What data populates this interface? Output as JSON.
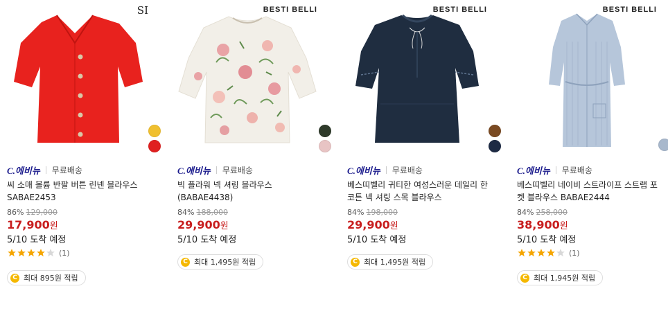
{
  "products": [
    {
      "brand_mark": "SI",
      "seller": "C.에비뉴",
      "shipping": "무료배송",
      "title": "씨 소매 볼륨 반팔 버튼 린넨 블라우스 SABAE2453",
      "discount": "86%",
      "original_price": "129,000",
      "price": "17,900",
      "currency": "원",
      "delivery": "5/10 도착 예정",
      "rating": 4,
      "rating_max": 5,
      "review_count": "(1)",
      "points": "최대 895원 적립",
      "swatch_colors": [
        "#f0c030",
        "#e02020"
      ],
      "garment_color": "#e8221e"
    },
    {
      "brand_mark": "BESTI BELLI",
      "seller": "C.에비뉴",
      "shipping": "무료배송",
      "title": "빅 플라워 넥 셔링 블라우스 (BABAE4438)",
      "discount": "84%",
      "original_price": "188,000",
      "price": "29,900",
      "currency": "원",
      "delivery": "5/10 도착 예정",
      "points": "최대 1,495원 적립",
      "swatch_colors": [
        "#2e3a2a",
        "#e8c4c4"
      ],
      "garment_color": "#f2efe8"
    },
    {
      "brand_mark": "BESTI BELLI",
      "seller": "C.에비뉴",
      "shipping": "무료배송",
      "title": "베스띠벨리 귀티한 여성스러운 데일리 한 코튼 넥 셔링 스목 블라우스",
      "discount": "84%",
      "original_price": "198,000",
      "price": "29,900",
      "currency": "원",
      "delivery": "5/10 도착 예정",
      "points": "최대 1,495원 적립",
      "swatch_colors": [
        "#7a4a22",
        "#1d2a44"
      ],
      "garment_color": "#1f2d40"
    },
    {
      "brand_mark": "BESTI BELLI",
      "seller": "C.에비뉴",
      "shipping": "무료배송",
      "title": "베스띠벨리 네이비 스트라이프 스트랩 포켓 블라우스 BABAE2444",
      "discount": "84%",
      "original_price": "258,000",
      "price": "38,900",
      "currency": "원",
      "delivery": "5/10 도착 예정",
      "rating": 4,
      "rating_max": 5,
      "review_count": "(1)",
      "points": "최대 1,945원 적립",
      "swatch_colors": [
        "#a8b8cc"
      ],
      "garment_color": "#b6c6da"
    }
  ],
  "coin_symbol": "C",
  "star_colors": {
    "filled": "#f5a500",
    "empty": "#d8d8d8"
  }
}
